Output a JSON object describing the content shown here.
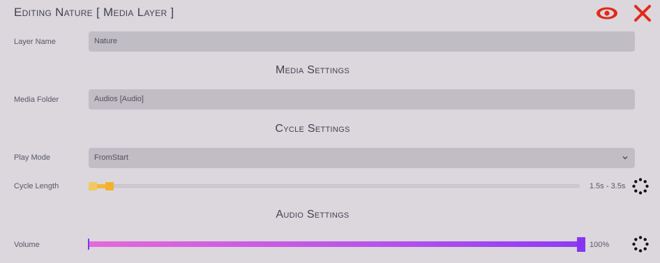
{
  "header": {
    "title": "Editing Nature [ Media Layer ]",
    "visibility_icon": "eye-icon",
    "close_icon": "close-icon",
    "icon_color": "#e02a1a"
  },
  "layer": {
    "label": "Layer Name",
    "value": "Nature"
  },
  "media_settings": {
    "title": "Media Settings",
    "folder_label": "Media Folder",
    "folder_value": "Audios [Audio]"
  },
  "cycle_settings": {
    "title": "Cycle Settings",
    "play_mode_label": "Play Mode",
    "play_mode_value": "FromStart",
    "cycle_length_label": "Cycle Length",
    "cycle_length_value": "1.5s - 3.5s",
    "slider_colors": [
      "#f0c965",
      "#f3b130"
    ]
  },
  "audio_settings": {
    "title": "Audio Settings",
    "volume_label": "Volume",
    "volume_value": "100%",
    "volume_fraction": 1.0,
    "gradient_colors": [
      "#e46ad9",
      "#8d3bf5"
    ]
  }
}
